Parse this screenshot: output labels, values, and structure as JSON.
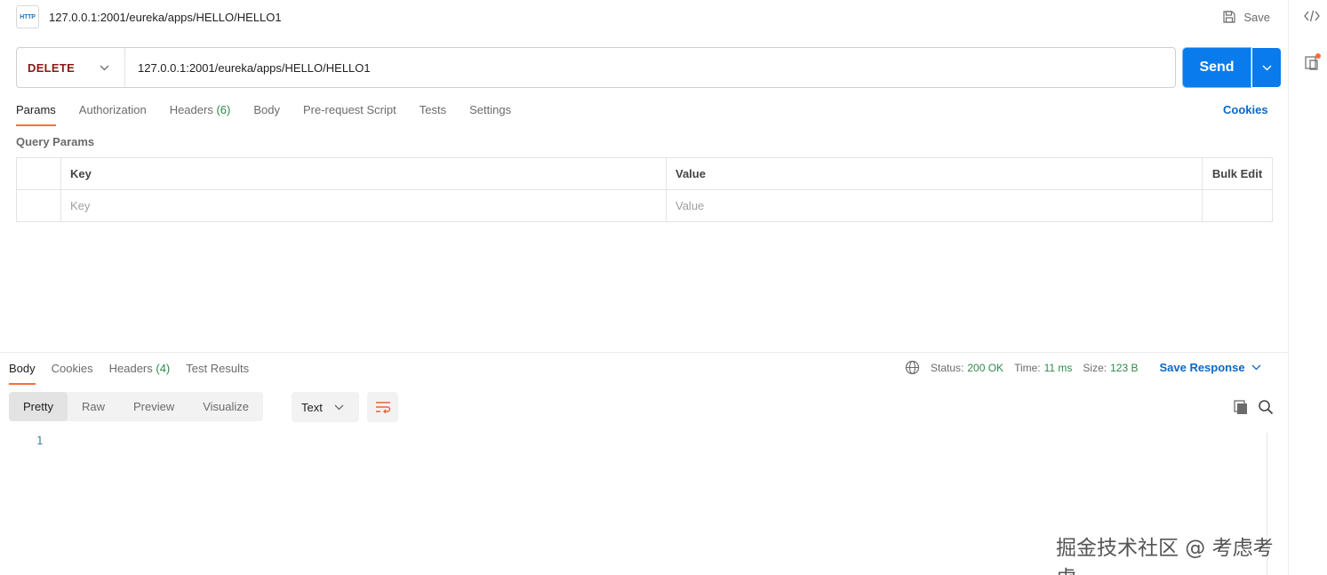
{
  "request": {
    "icon_text": "HTTP",
    "title": "127.0.0.1:2001/eureka/apps/HELLO/HELLO1",
    "save_label": "Save",
    "method": "DELETE",
    "url": "127.0.0.1:2001/eureka/apps/HELLO/HELLO1",
    "send_label": "Send"
  },
  "request_tabs": {
    "params": "Params",
    "authorization": "Authorization",
    "headers": "Headers",
    "headers_count": "(6)",
    "body": "Body",
    "prerequest": "Pre-request Script",
    "tests": "Tests",
    "settings": "Settings",
    "cookies": "Cookies"
  },
  "query_params": {
    "label": "Query Params",
    "col_key": "Key",
    "col_value": "Value",
    "bulk_edit": "Bulk Edit",
    "key_placeholder": "Key",
    "value_placeholder": "Value"
  },
  "response_tabs": {
    "body": "Body",
    "cookies": "Cookies",
    "headers": "Headers",
    "headers_count": "(4)",
    "test_results": "Test Results"
  },
  "response_status": {
    "status_label": "Status:",
    "status_value": "200 OK",
    "time_label": "Time:",
    "time_value": "11 ms",
    "size_label": "Size:",
    "size_value": "123 B",
    "save_response": "Save Response"
  },
  "view": {
    "pretty": "Pretty",
    "raw": "Raw",
    "preview": "Preview",
    "visualize": "Visualize",
    "format": "Text"
  },
  "editor": {
    "line_number": "1"
  },
  "watermark": "掘金技术社区 @ 考虑考虑",
  "colors": {
    "accent": "#ff6c37",
    "send": "#097bed",
    "method_delete": "#8b1a14",
    "status_green": "#2c8a4a",
    "link_blue": "#0a69c7"
  }
}
